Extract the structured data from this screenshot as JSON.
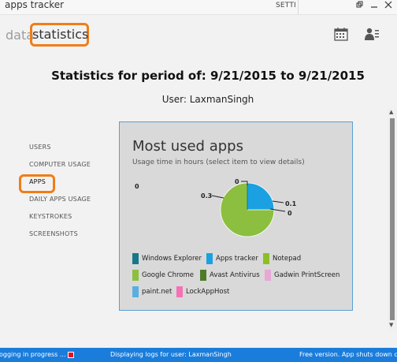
{
  "window": {
    "title": "apps tracker",
    "menu_settings": "SETTI",
    "controls": [
      "restore-icon",
      "minimize-icon",
      "close-icon"
    ]
  },
  "tabs": {
    "data": "data",
    "statistics": "statistics"
  },
  "top_icons": [
    "calendar-icon",
    "user-settings-icon"
  ],
  "header": {
    "period_title": "Statistics for period of: 9/21/2015 to 9/21/2015",
    "user_line": "User: LaxmanSingh"
  },
  "nav": {
    "items": [
      "USERS",
      "COMPUTER USAGE",
      "APPS",
      "DAILY APPS USAGE",
      "KEYSTROKES",
      "SCREENSHOTS"
    ],
    "selected": "APPS"
  },
  "panel": {
    "title": "Most used apps",
    "subtitle": "Usage time in hours (select item to view details)",
    "zero_label": "0"
  },
  "chart_data": {
    "type": "pie",
    "values": [
      {
        "label": "Apps tracker",
        "value": 0.1,
        "color": "#1ba1e2"
      },
      {
        "label": "Notepad",
        "value": 0,
        "color": "#8cbf26"
      },
      {
        "label": "Google Chrome",
        "value": 0.3,
        "color": "#8cbf3f"
      },
      {
        "label": "Windows Explorer",
        "value": 0,
        "color": "#0e7c86"
      }
    ],
    "data_labels": [
      "0",
      "0.1",
      "0",
      "0.3"
    ]
  },
  "legend": [
    {
      "label": "Windows Explorer",
      "color": "#16788a"
    },
    {
      "label": "Apps tracker",
      "color": "#1ba1e2"
    },
    {
      "label": "Notepad",
      "color": "#8cbf26"
    },
    {
      "label": "Google Chrome",
      "color": "#8cbf3f"
    },
    {
      "label": "Avast Antivirus",
      "color": "#4f7a2a"
    },
    {
      "label": "Gadwin PrintScreen",
      "color": "#e7a8d6"
    },
    {
      "label": "paint.net",
      "color": "#5aaee0"
    },
    {
      "label": "LockAppHost",
      "color": "#f472b6"
    }
  ],
  "status": {
    "logging": "ogging in progress ...",
    "displaying": "Displaying logs for user: LaxmanSingh",
    "version": "Free version. App shuts down c"
  },
  "colors": {
    "accent_orange": "#f07d17",
    "status_blue": "#1a7ddb",
    "panel_border": "#5a9fd4"
  }
}
